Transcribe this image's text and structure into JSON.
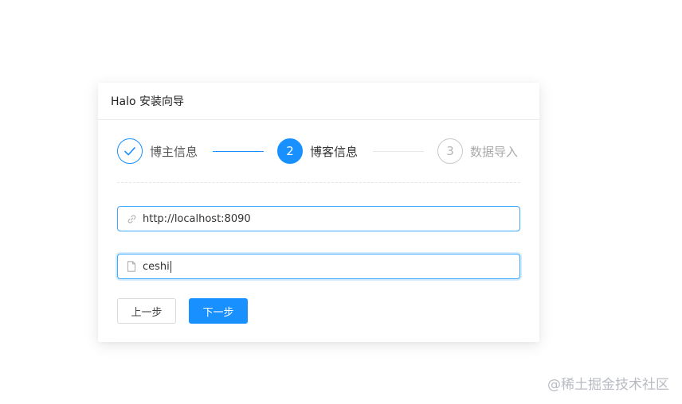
{
  "window": {
    "title": "Halo 安装向导"
  },
  "steps": [
    {
      "number": "",
      "label": "博主信息",
      "status": "done",
      "icon": "check-icon"
    },
    {
      "number": "2",
      "label": "博客信息",
      "status": "active"
    },
    {
      "number": "3",
      "label": "数据导入",
      "status": "waiting"
    }
  ],
  "form": {
    "url_value": "http://localhost:8090",
    "url_icon": "link-icon",
    "title_value": "ceshi",
    "title_icon": "file-icon"
  },
  "buttons": {
    "prev": "上一步",
    "next": "下一步"
  },
  "watermark": "@稀土掘金技术社区",
  "colors": {
    "primary": "#1890ff",
    "waiting": "#c8c8c8",
    "border": "#d9d9d9"
  }
}
